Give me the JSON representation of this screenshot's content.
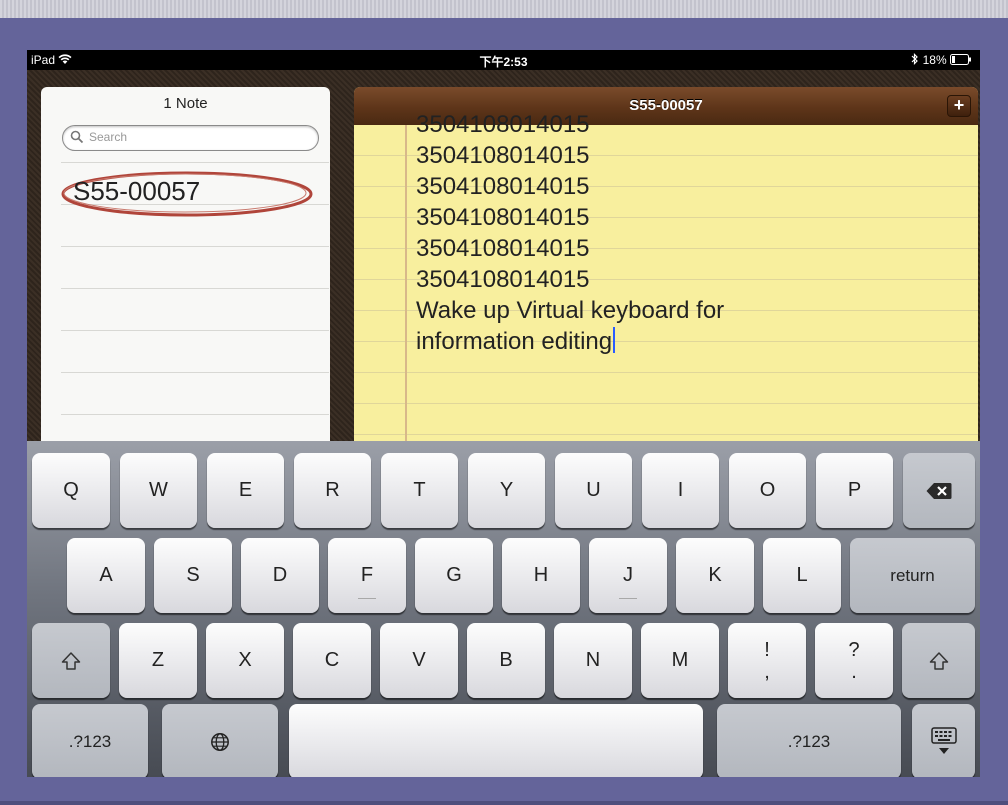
{
  "status": {
    "device": "iPad",
    "time": "下午2:53",
    "battery": "18%"
  },
  "list": {
    "title": "1 Note",
    "search_placeholder": "Search",
    "notes": [
      "S55-00057"
    ]
  },
  "note": {
    "title": "S55-00057",
    "add_label": "+",
    "lines": [
      "3504108014015",
      "3504108014015",
      "3504108014015",
      "3504108014015",
      "3504108014015",
      "3504108014015",
      "Wake up Virtual keyboard for",
      "information editing"
    ]
  },
  "keyboard": {
    "row1": [
      "Q",
      "W",
      "E",
      "R",
      "T",
      "Y",
      "U",
      "I",
      "O",
      "P"
    ],
    "row2": [
      "A",
      "S",
      "D",
      "F",
      "G",
      "H",
      "J",
      "K",
      "L"
    ],
    "row3": [
      "Z",
      "X",
      "C",
      "V",
      "B",
      "N",
      "M"
    ],
    "return_label": "return",
    "numbers_label": ".?123",
    "punct_1": [
      "!",
      ","
    ],
    "punct_2": [
      "?",
      "."
    ]
  },
  "colors": {
    "accent_circle": "#b0453a",
    "paper": "#f7ef9d",
    "leather": "#5e3519"
  }
}
